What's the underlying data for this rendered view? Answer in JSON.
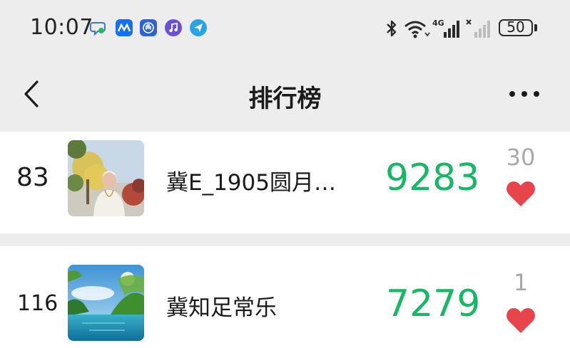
{
  "status_bar": {
    "time": "10:07",
    "network_type": "4G",
    "battery": "50",
    "notification_icons": [
      "chat-bubble-icon",
      "meitu-app-icon",
      "hand-app-icon",
      "music-icon",
      "paper-plane-icon"
    ]
  },
  "navbar": {
    "title": "排行榜"
  },
  "ranking": [
    {
      "rank": "83",
      "name": "冀E_1905圆月…",
      "steps": "9283",
      "likes": "30"
    },
    {
      "rank": "116",
      "name": "冀知足常乐",
      "steps": "7279",
      "likes": "1"
    }
  ],
  "colors": {
    "steps": "#16b865",
    "heart": "#e8454a",
    "likes": "#a8a8a8",
    "background": "#ededed"
  }
}
